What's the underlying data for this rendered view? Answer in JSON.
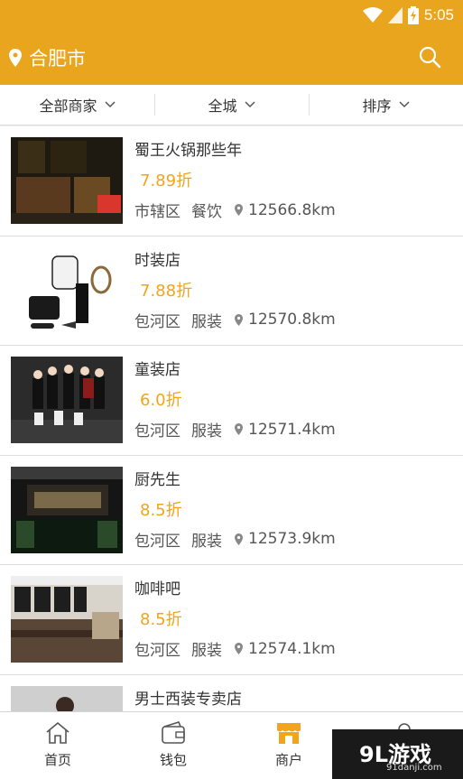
{
  "status_bar": {
    "time": "5:05"
  },
  "header": {
    "city": "合肥市",
    "icons": [
      "location-pin-icon",
      "search-icon"
    ]
  },
  "filters": [
    {
      "label": "全部商家"
    },
    {
      "label": "全城"
    },
    {
      "label": "排序"
    }
  ],
  "merchants": [
    {
      "name": "蜀王火锅那些年",
      "discount": "7.89折",
      "district": "市辖区",
      "category": "餐饮",
      "distance": "12566.8km"
    },
    {
      "name": "时装店",
      "discount": "7.88折",
      "district": "包河区",
      "category": "服装",
      "distance": "12570.8km"
    },
    {
      "name": "童装店",
      "discount": "6.0折",
      "district": "包河区",
      "category": "服装",
      "distance": "12571.4km"
    },
    {
      "name": "厨先生",
      "discount": "8.5折",
      "district": "包河区",
      "category": "服装",
      "distance": "12573.9km"
    },
    {
      "name": "咖啡吧",
      "discount": "8.5折",
      "district": "包河区",
      "category": "服装",
      "distance": "12574.1km"
    },
    {
      "name": "男士西装专卖店",
      "discount": "",
      "district": "",
      "category": "",
      "distance": ""
    }
  ],
  "bottom_nav": [
    {
      "label": "首页",
      "icon": "home-icon"
    },
    {
      "label": "钱包",
      "icon": "wallet-icon"
    },
    {
      "label": "商户",
      "icon": "store-icon",
      "active": true
    },
    {
      "label": "",
      "icon": "profile-icon"
    }
  ],
  "watermark": {
    "logo": "9L游戏",
    "site": "91danji.com"
  },
  "colors": {
    "accent": "#eaa51f",
    "discount": "#f0a51b"
  }
}
